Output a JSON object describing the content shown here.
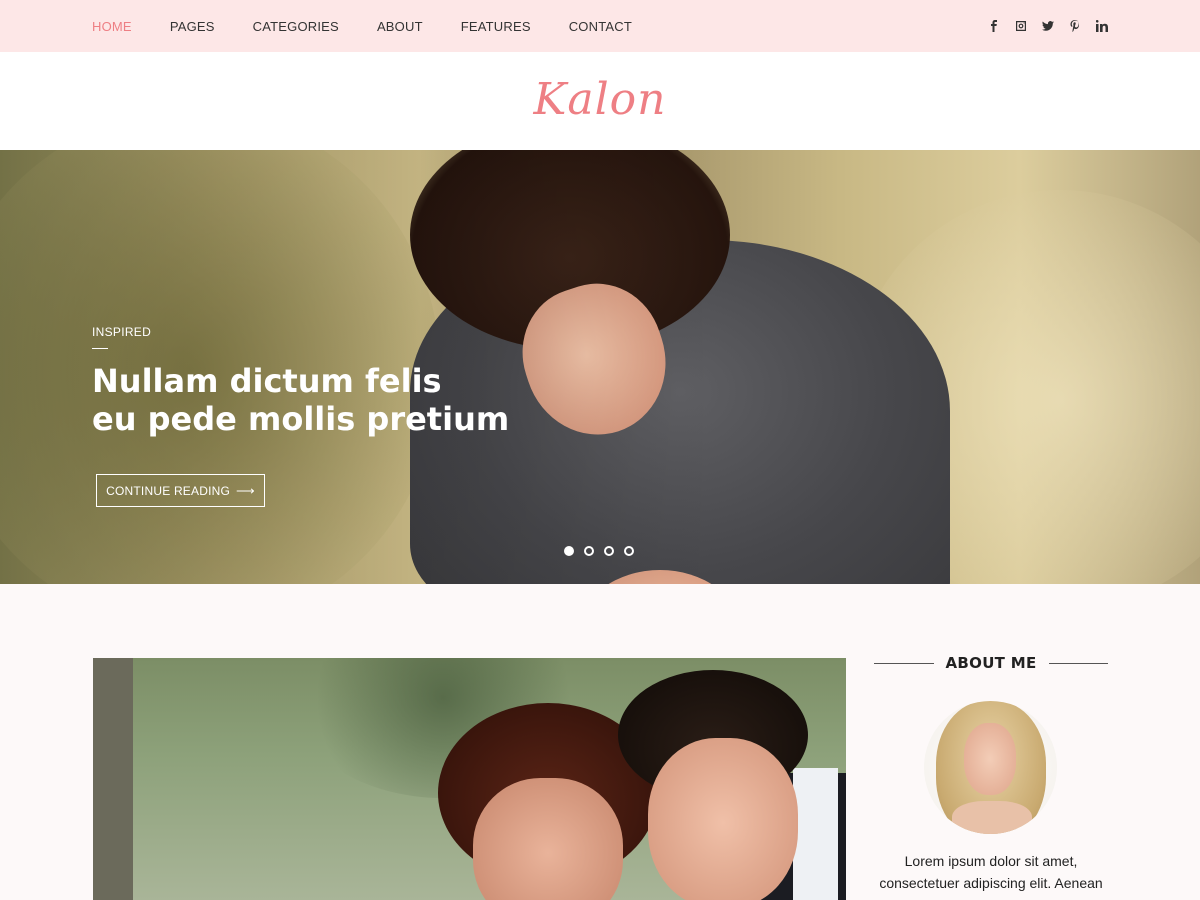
{
  "nav": {
    "items": [
      {
        "label": "HOME",
        "active": true
      },
      {
        "label": "PAGES",
        "active": false
      },
      {
        "label": "CATEGORIES",
        "active": false
      },
      {
        "label": "ABOUT",
        "active": false
      },
      {
        "label": "FEATURES",
        "active": false
      },
      {
        "label": "CONTACT",
        "active": false
      }
    ],
    "social": [
      "facebook-icon",
      "instagram-icon",
      "twitter-icon",
      "pinterest-icon",
      "linkedin-icon"
    ]
  },
  "logo": {
    "text": "Kalon"
  },
  "hero": {
    "category": "INSPIRED",
    "title_line1": "Nullam dictum felis",
    "title_line2": "eu pede mollis pretium",
    "button_label": "CONTINUE READING",
    "slides": 4,
    "active_slide": 1
  },
  "sidebar": {
    "about_title": "ABOUT ME",
    "about_text_line1": "Lorem ipsum dolor sit amet,",
    "about_text_line2": "consectetuer adipiscing elit. Aenean"
  },
  "colors": {
    "accent": "#ee7f84",
    "topbar": "#fde7e7",
    "background": "#fdf9f9"
  }
}
